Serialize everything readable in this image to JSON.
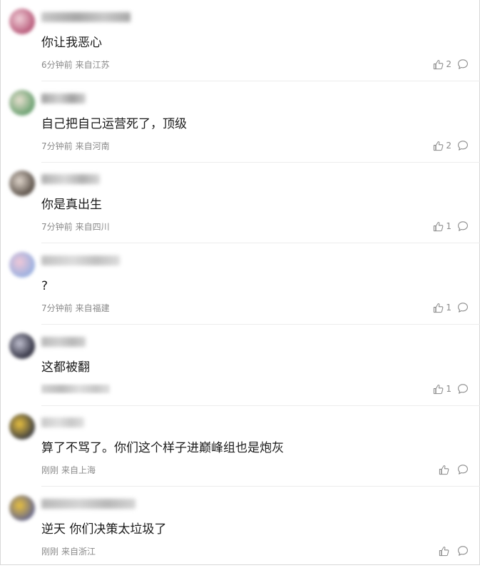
{
  "comments": [
    {
      "avatar_colors": [
        "#b85a7a",
        "#f0d0d8"
      ],
      "username_colors": [
        "#c8c8c8",
        "#a8a8a8"
      ],
      "username_width": 125,
      "text": "你让我恶心",
      "time": "6分钟前",
      "location": "来自江苏",
      "likes": "2",
      "meta_visible": true
    },
    {
      "avatar_colors": [
        "#6aa070",
        "#e8e0d0"
      ],
      "username_colors": [
        "#a0a0a0",
        "#d0d0d0"
      ],
      "username_width": 62,
      "text": "自己把自己运营死了，顶级",
      "time": "7分钟前",
      "location": "来自河南",
      "likes": "2",
      "meta_visible": true
    },
    {
      "avatar_colors": [
        "#5a5048",
        "#e0d6cc"
      ],
      "username_colors": [
        "#b0b0b0",
        "#d8d8d8"
      ],
      "username_width": 82,
      "text": "你是真出生",
      "time": "7分钟前",
      "location": "来自四川",
      "likes": "1",
      "meta_visible": true
    },
    {
      "avatar_colors": [
        "#9ab0e0",
        "#f0c8d8"
      ],
      "username_colors": [
        "#c0c0c0",
        "#dcdcdc"
      ],
      "username_width": 110,
      "text": "?",
      "time": "7分钟前",
      "location": "来自福建",
      "likes": "1",
      "meta_visible": true
    },
    {
      "avatar_colors": [
        "#303040",
        "#c0c0d0"
      ],
      "username_colors": [
        "#b8b8b8",
        "#d0d0d0"
      ],
      "username_width": 62,
      "text": "这都被翻",
      "time": "",
      "location": "",
      "likes": "1",
      "meta_visible": false
    },
    {
      "avatar_colors": [
        "#404040",
        "#e8c040"
      ],
      "username_colors": [
        "#c8c8c8",
        "#e0e0e0"
      ],
      "username_width": 60,
      "text": "算了不骂了。你们这个样子进巅峰组也是炮灰",
      "time": "刚刚",
      "location": "来自上海",
      "likes": "",
      "meta_visible": true
    },
    {
      "avatar_colors": [
        "#6a6a8a",
        "#e8c040"
      ],
      "username_colors": [
        "#b8b8b8",
        "#d4d4d4"
      ],
      "username_width": 132,
      "text": "逆天 你们决策太垃圾了",
      "time": "刚刚",
      "location": "来自浙江",
      "likes": "",
      "meta_visible": true
    }
  ]
}
